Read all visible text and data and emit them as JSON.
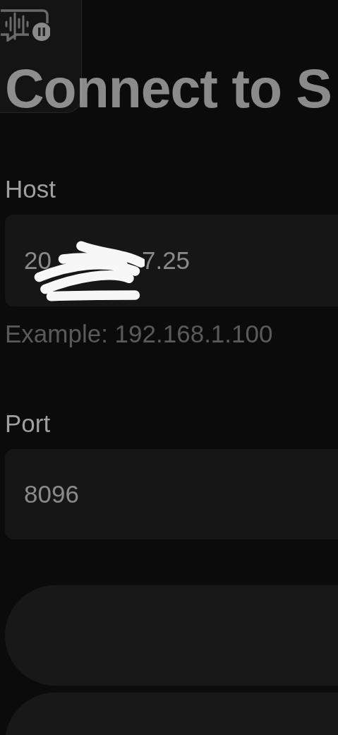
{
  "title": "Connect to S",
  "host": {
    "label": "Host",
    "value_start": "20",
    "value_end": "7.25",
    "redacted": true,
    "hint": "Example: 192.168.1.100"
  },
  "port": {
    "label": "Port",
    "value": "8096"
  },
  "buttons": [
    {
      "kind": "pill"
    },
    {
      "kind": "pill"
    }
  ],
  "overlay": {
    "paused": true
  }
}
